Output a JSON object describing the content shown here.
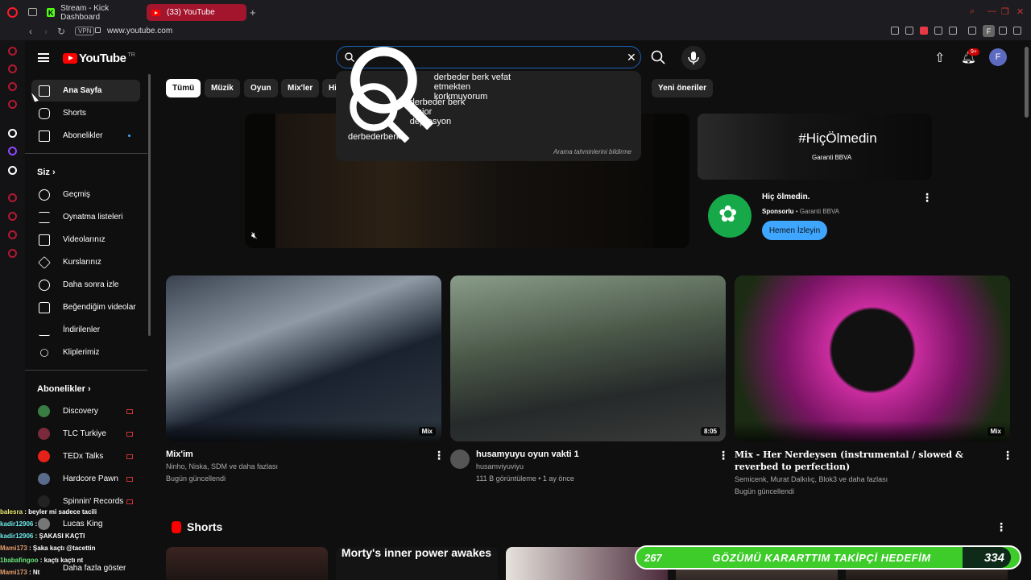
{
  "browser": {
    "tabs": [
      {
        "label": "Stream - Kick Dashboard",
        "favicon": "K"
      },
      {
        "label": "(33) YouTube",
        "active": true
      }
    ],
    "url": "www.youtube.com",
    "vpn_label": "VPN",
    "profile_initial": "F"
  },
  "header": {
    "logo_text": "YouTube",
    "logo_sup": "TR",
    "search_value": "v",
    "notification_count": "9+",
    "avatar_initial": "F"
  },
  "suggestions": {
    "items": [
      "derbeder berk vefat etmekten korkmuyorum",
      "derbeder berk major depresyon",
      "derbederberk"
    ],
    "note": "Arama tahminlerini bildirme"
  },
  "sidebar": {
    "main": [
      {
        "label": "Ana Sayfa",
        "icon": "home-icon",
        "active": true
      },
      {
        "label": "Shorts",
        "icon": "shorts-icon"
      },
      {
        "label": "Abonelikler",
        "icon": "subscriptions-icon"
      }
    ],
    "you_heading": "Siz",
    "you": [
      {
        "label": "Geçmiş",
        "icon": "history-icon"
      },
      {
        "label": "Oynatma listeleri",
        "icon": "playlists-icon"
      },
      {
        "label": "Videolarınız",
        "icon": "your-videos-icon"
      },
      {
        "label": "Kurslarınız",
        "icon": "courses-icon"
      },
      {
        "label": "Daha sonra izle",
        "icon": "watch-later-icon"
      },
      {
        "label": "Beğendiğim videolar",
        "icon": "liked-icon"
      },
      {
        "label": "İndirilenler",
        "icon": "downloads-icon"
      },
      {
        "label": "Kliplerimiz",
        "icon": "clips-icon"
      }
    ],
    "subs_heading": "Abonelikler",
    "subs": [
      {
        "label": "Discovery",
        "color": "#3a7d44"
      },
      {
        "label": "TLC Turkiye",
        "color": "#7a2a3a"
      },
      {
        "label": "TEDx Talks",
        "color": "#e62117"
      },
      {
        "label": "Hardcore Pawn",
        "color": "#5a6a8a"
      },
      {
        "label": "Spinnin' Records",
        "color": "#222222"
      },
      {
        "label": "Lucas King",
        "color": "#777777"
      }
    ],
    "show_more": "Daha fazla göster"
  },
  "chips": [
    "Tümü",
    "Müzik",
    "Oyun",
    "Mix'ler",
    "Hi",
    "Yeni öneriler"
  ],
  "ad": {
    "banner_title": "#HiçÖlmedin",
    "banner_brand": "Garanti BBVA",
    "title": "Hiç ölmedin.",
    "sponsored": "Sponsorlu",
    "advertiser": "Garanti BBVA",
    "cta": "Hemen İzleyin"
  },
  "videos": [
    {
      "title": "Mix'im",
      "line1": "Ninho, Niska, SDM ve daha fazlası",
      "line2": "Bugün güncellendi",
      "badge": "Mix"
    },
    {
      "title": "husamyuyu oyun vakti 1",
      "line1": "husamviyuviyu",
      "line2": "111 B görüntüleme • 1 ay önce",
      "badge": "8:05"
    },
    {
      "title": "Mix - Her Nerdeysen (instrumental / slowed & reverbed to perfection)",
      "line1": "Semicenk, Murat Dalkılıç, Blok3 ve daha fazlası",
      "line2": "Bugün güncellendi",
      "badge": "Mix"
    }
  ],
  "shorts": {
    "heading": "Shorts",
    "item_text": "Morty's inner power awakes"
  },
  "overlay": {
    "chat": [
      {
        "user": "balesra",
        "msg": "beyler mi sadece tacili"
      },
      {
        "user": "kadir12906",
        "msg": ""
      },
      {
        "user": "kadir12906",
        "msg": "ŞAKASI KAÇTI"
      },
      {
        "user": "Mami173",
        "msg": "Şaka kaçtı @tacettin"
      },
      {
        "user": "1babafingoo",
        "msg": "kaçtı kaçtı nt"
      },
      {
        "user": "Mami173",
        "msg": "Nt"
      }
    ],
    "goal_current": "267",
    "goal_text": "GÖZÜMÜ KARARTTIM TAKİPÇİ HEDEFİM",
    "goal_target": "334"
  }
}
